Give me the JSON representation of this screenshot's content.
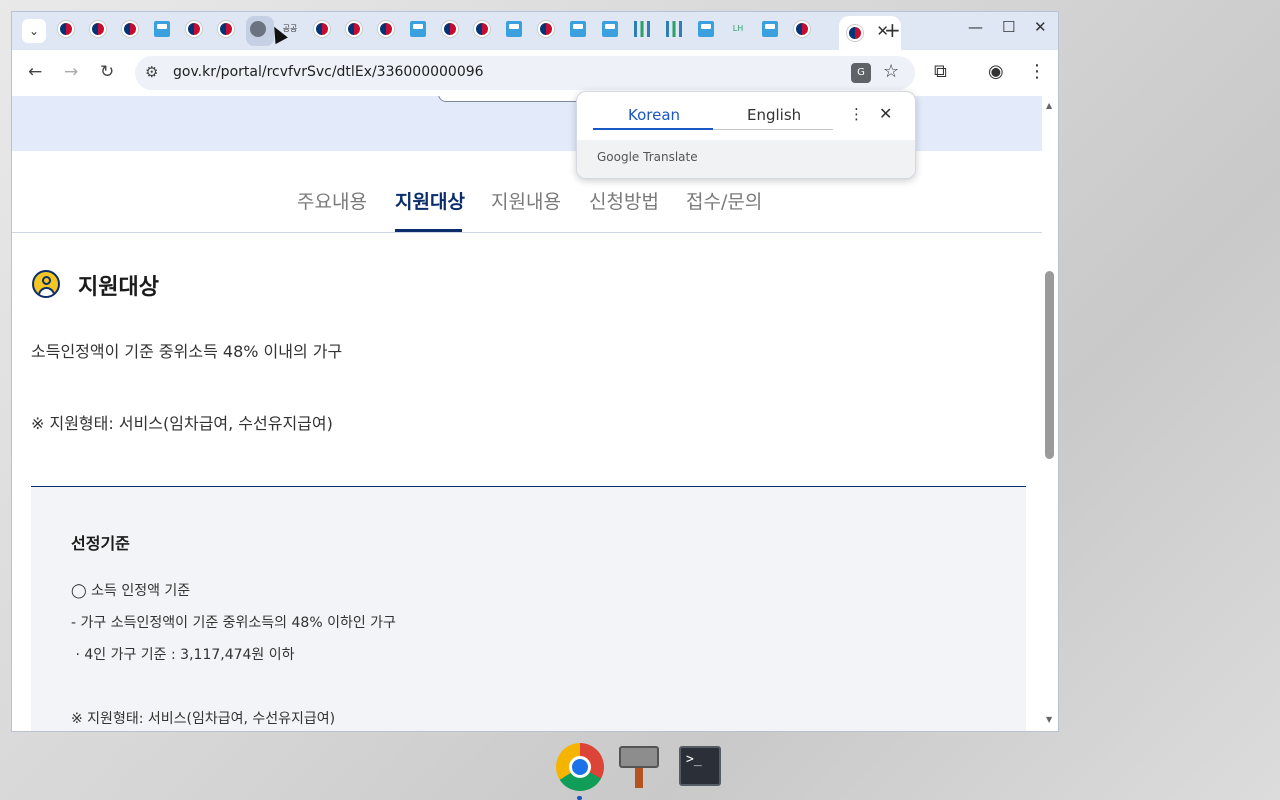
{
  "browser": {
    "url": "gov.kr/portal/rcvfvrSvc/dtlEx/336000000096",
    "favicons": [
      "kr",
      "kr",
      "kr",
      "sq",
      "kr",
      "kr",
      "globe",
      "txt",
      "kr",
      "kr",
      "kr",
      "sq",
      "kr",
      "kr",
      "sq",
      "kr",
      "sq",
      "sq",
      "bar",
      "bar",
      "sq",
      "lh",
      "sq",
      "kr"
    ],
    "favicon_text": "공공",
    "favicon_lh": "LH"
  },
  "translate_popup": {
    "tab_korean": "Korean",
    "tab_english": "English",
    "brand": "Google Translate"
  },
  "content_tabs": [
    "주요내용",
    "지원대상",
    "지원내용",
    "신청방법",
    "접수/문의"
  ],
  "active_tab": "지원대상",
  "section": {
    "title": "지원대상",
    "para1": "소득인정액이 기준 중위소득 48% 이내의 가구",
    "para2": "※ 지원형태: 서비스(임차급여, 수선유지급여)"
  },
  "criteria": {
    "title": "선정기준",
    "lines": [
      "◯ 소득 인정액 기준",
      "- 가구 소득인정액이 기준 중위소득의 48% 이하인 가구",
      " · 4인 가구 기준 : 3,117,474원 이하",
      "※ 지원형태: 서비스(임차급여, 수선유지급여)"
    ]
  },
  "dock": {
    "terminal_label": ">_"
  }
}
